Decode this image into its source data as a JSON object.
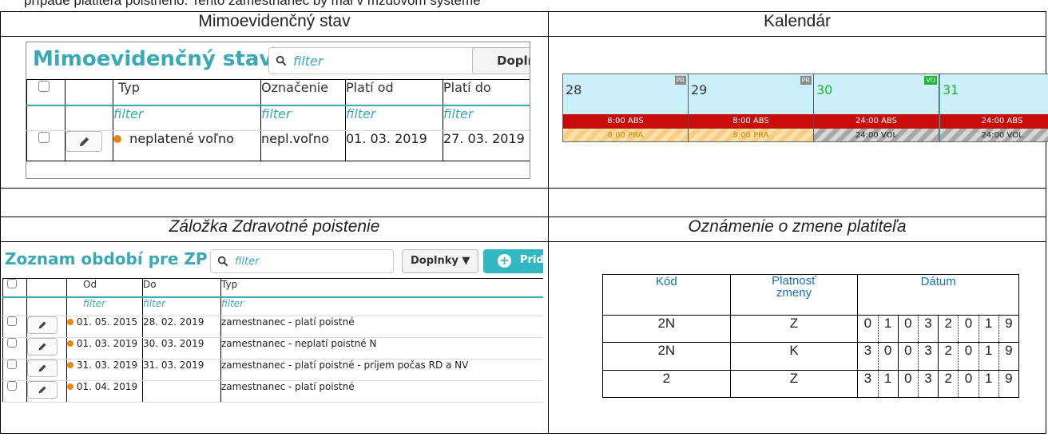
{
  "top_fragment": "prípade platiteľa poistného. Tento zamestnanec by mal v mzdovom systéme",
  "headers": {
    "a": "Mimoevidenčný stav",
    "b": "Kalendár",
    "c_prefix": "Záložka ",
    "c_italic": "Zdravotné poistenie",
    "d": "Oznámenie o zmene platiteľa"
  },
  "panelA": {
    "title": "Mimoevidenčný stav",
    "search_placeholder": "filter",
    "addons_label": "Doplnk",
    "columns": [
      "Typ",
      "Označenie",
      "Platí od",
      "Platí do"
    ],
    "filter_label": "filter",
    "rows": [
      {
        "type": "neplatené voľno",
        "mark": "nepl.voľno",
        "from": "01. 03. 2019",
        "to": "27. 03. 2019",
        "status_color": "#e8890c"
      }
    ]
  },
  "calendar": {
    "days": [
      {
        "day": "28",
        "badge": "PR",
        "badge_color": "#888888",
        "row1": "8:00 ABS",
        "row2": "8:00 PRA",
        "row2_kind": "pra",
        "day_color": "#333333"
      },
      {
        "day": "29",
        "badge": "PR",
        "badge_color": "#888888",
        "row1": "8:00 ABS",
        "row2": "8:00 PRA",
        "row2_kind": "pra",
        "day_color": "#333333"
      },
      {
        "day": "30",
        "badge": "VO",
        "badge_color": "#1fb52b",
        "row1": "24:00 ABS",
        "row2": "24:00 VOL",
        "row2_kind": "vol",
        "day_color": "#1fb52b"
      },
      {
        "day": "31",
        "badge": "",
        "badge_color": "#1fb52b",
        "row1": "24:00 ABS",
        "row2": "24:00 VOL",
        "row2_kind": "vol",
        "day_color": "#1fb52b"
      }
    ],
    "colors": {
      "header_bg": "#cbf0fb",
      "abs_bar": "#c80c0c"
    }
  },
  "panelC": {
    "title": "Zoznam období pre ZP",
    "search_placeholder": "filter",
    "addons_label": "Doplnky ▼",
    "add_label": "Pridá",
    "columns": [
      "Od",
      "Do",
      "Typ"
    ],
    "filter_label": "filter",
    "rows": [
      {
        "from": "01. 05. 2015",
        "to": "28. 02. 2019",
        "type": "zamestnanec - platí poistné"
      },
      {
        "from": "01. 03. 2019",
        "to": "30. 03. 2019",
        "type": "zamestnanec - neplatí poistné N"
      },
      {
        "from": "31. 03. 2019",
        "to": "31. 03. 2019",
        "type": "zamestnanec - platí poistné - príjem počas RD a NV"
      },
      {
        "from": "01. 04. 2019",
        "to": "",
        "type": "zamestnanec - platí poistné"
      }
    ]
  },
  "notice": {
    "columns": {
      "code": "Kód",
      "validity_line1": "Platnosť",
      "validity_line2": "zmeny",
      "date": "Dátum"
    },
    "rows": [
      {
        "code": "2N",
        "validity": "Z",
        "date_digits": [
          "0",
          "1",
          "0",
          "3",
          "2",
          "0",
          "1",
          "9"
        ]
      },
      {
        "code": "2N",
        "validity": "K",
        "date_digits": [
          "3",
          "0",
          "0",
          "3",
          "2",
          "0",
          "1",
          "9"
        ]
      },
      {
        "code": "2",
        "validity": "Z",
        "date_digits": [
          "3",
          "1",
          "0",
          "3",
          "2",
          "0",
          "1",
          "9"
        ]
      }
    ],
    "colors": {
      "border": "#1a8a8c",
      "header_text": "#1a6fb3"
    }
  }
}
